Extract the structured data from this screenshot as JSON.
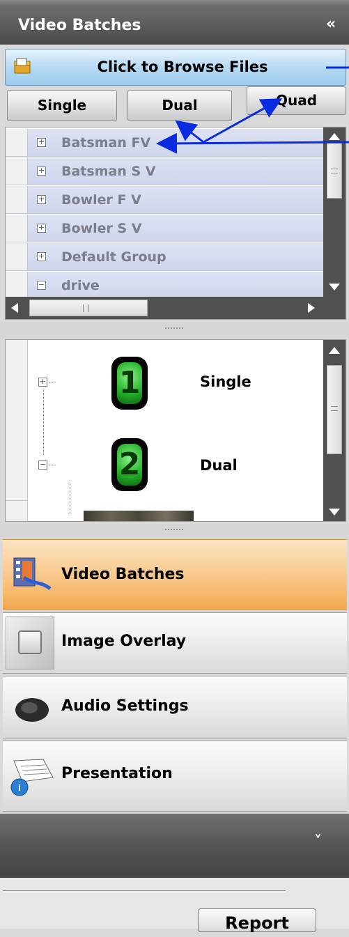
{
  "header": {
    "title": "Video  Batches",
    "collapse_glyph": "«"
  },
  "browse": {
    "label": "Click to Browse Files",
    "icon": "folder-open-icon"
  },
  "modes": {
    "single": "Single",
    "dual": "Dual",
    "quad": "Quad"
  },
  "groups": [
    {
      "label": "Batsman FV",
      "expander": "+"
    },
    {
      "label": "Batsman S V",
      "expander": "+"
    },
    {
      "label": "Bowler  F V",
      "expander": "+"
    },
    {
      "label": "Bowler S V",
      "expander": "+"
    },
    {
      "label": "Default Group",
      "expander": "+"
    },
    {
      "label": "drive",
      "expander": "−"
    }
  ],
  "tree": [
    {
      "label": "Single",
      "number": "1",
      "expander": "+"
    },
    {
      "label": "Dual",
      "number": "2",
      "expander": "−"
    }
  ],
  "nav": [
    {
      "label": "Video  Batches",
      "icon": "film-icon",
      "active": true
    },
    {
      "label": "Image Overlay",
      "icon": "image-overlay-icon",
      "active": false
    },
    {
      "label": "Audio Settings",
      "icon": "speaker-icon",
      "active": false
    },
    {
      "label": "Presentation",
      "icon": "presentation-icon",
      "active": false
    }
  ],
  "footer": {
    "chevron": "˅",
    "report_label": "Report"
  },
  "colors": {
    "accent_blue": "#0a2be0",
    "header": "#5a5a5a",
    "active_nav": "#f9c98e"
  }
}
